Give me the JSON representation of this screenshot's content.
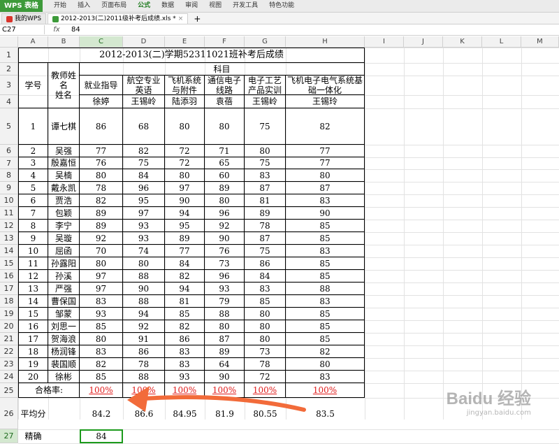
{
  "app": {
    "logo": "WPS 表格",
    "menu": [
      "开始",
      "插入",
      "页面布局",
      "公式",
      "数据",
      "审阅",
      "视图",
      "开发工具",
      "特色功能"
    ],
    "active_menu": "公式"
  },
  "tabs": [
    {
      "label": "我的WPS"
    },
    {
      "label": "2012-2013(二)2011级补考后成绩.xls *"
    }
  ],
  "formula_bar": {
    "cell_ref": "C27",
    "fx": "fx",
    "value": "84"
  },
  "columns": [
    "A",
    "B",
    "C",
    "D",
    "E",
    "F",
    "G",
    "H",
    "I",
    "J",
    "K",
    "L",
    "M"
  ],
  "rows": [
    "1",
    "2",
    "3",
    "4",
    "5",
    "6",
    "7",
    "8",
    "9",
    "10",
    "11",
    "12",
    "13",
    "14",
    "15",
    "16",
    "17",
    "18",
    "19",
    "20",
    "21",
    "22",
    "23",
    "24",
    "25",
    "26",
    "27"
  ],
  "sheet": {
    "title": "2012-2013(二)学期52311021班补考后成绩",
    "h_xuehao": "学号",
    "h_teacher": "教师姓名\n姓名",
    "h_subject": "科目",
    "subjects": [
      "就业指导",
      "航空专业英语",
      "飞机系统与附件",
      "通信电子线路",
      "电子工艺产品实训",
      "飞机电子电气系统基础一体化"
    ],
    "teachers": [
      "徐婷",
      "王锡岭",
      "陆添羽",
      "袁蓓",
      "王锡岭",
      "王锡玲"
    ],
    "students": [
      {
        "no": "1",
        "name": "谭七棋",
        "scores": [
          "86",
          "68",
          "80",
          "80",
          "75",
          "82"
        ]
      },
      {
        "no": "2",
        "name": "吴强",
        "scores": [
          "77",
          "82",
          "72",
          "71",
          "80",
          "77"
        ]
      },
      {
        "no": "3",
        "name": "殷嘉恒",
        "scores": [
          "76",
          "75",
          "72",
          "65",
          "75",
          "77"
        ]
      },
      {
        "no": "4",
        "name": "吴楠",
        "scores": [
          "80",
          "84",
          "80",
          "60",
          "83",
          "80"
        ]
      },
      {
        "no": "5",
        "name": "戴永凯",
        "scores": [
          "78",
          "96",
          "97",
          "89",
          "87",
          "87"
        ]
      },
      {
        "no": "6",
        "name": "贾浩",
        "scores": [
          "82",
          "95",
          "90",
          "80",
          "81",
          "83"
        ]
      },
      {
        "no": "7",
        "name": "包颖",
        "scores": [
          "89",
          "97",
          "94",
          "96",
          "89",
          "90"
        ]
      },
      {
        "no": "8",
        "name": "李宁",
        "scores": [
          "89",
          "93",
          "95",
          "92",
          "78",
          "85"
        ]
      },
      {
        "no": "9",
        "name": "吴璇",
        "scores": [
          "92",
          "93",
          "89",
          "90",
          "87",
          "85"
        ]
      },
      {
        "no": "10",
        "name": "屈函",
        "scores": [
          "70",
          "74",
          "77",
          "76",
          "75",
          "83"
        ]
      },
      {
        "no": "11",
        "name": "孙露阳",
        "scores": [
          "80",
          "80",
          "84",
          "73",
          "86",
          "85"
        ]
      },
      {
        "no": "12",
        "name": "孙溪",
        "scores": [
          "97",
          "88",
          "82",
          "96",
          "84",
          "85"
        ]
      },
      {
        "no": "13",
        "name": "严强",
        "scores": [
          "97",
          "90",
          "94",
          "93",
          "83",
          "88"
        ]
      },
      {
        "no": "14",
        "name": "曹保国",
        "scores": [
          "83",
          "88",
          "81",
          "79",
          "85",
          "83"
        ]
      },
      {
        "no": "15",
        "name": "邹蒙",
        "scores": [
          "93",
          "94",
          "85",
          "88",
          "80",
          "85"
        ]
      },
      {
        "no": "16",
        "name": "刘思一",
        "scores": [
          "85",
          "92",
          "82",
          "80",
          "80",
          "85"
        ]
      },
      {
        "no": "17",
        "name": "贺海浪",
        "scores": [
          "80",
          "91",
          "86",
          "87",
          "80",
          "85"
        ]
      },
      {
        "no": "18",
        "name": "杨润锋",
        "scores": [
          "83",
          "86",
          "83",
          "89",
          "73",
          "82"
        ]
      },
      {
        "no": "19",
        "name": "裴国顺",
        "scores": [
          "82",
          "78",
          "83",
          "64",
          "78",
          "80"
        ]
      },
      {
        "no": "20",
        "name": "徐彬",
        "scores": [
          "85",
          "88",
          "93",
          "90",
          "72",
          "83"
        ]
      }
    ],
    "pass_label": "合格率:",
    "pass_rates": [
      "100%",
      "100%",
      "100%",
      "100%",
      "100%",
      "100%"
    ],
    "avg_label": "平均分",
    "averages": [
      "84.2",
      "86.6",
      "84.95",
      "81.9",
      "80.55",
      "83.5"
    ],
    "exact_label": "精确",
    "exact_value": "84"
  },
  "watermark": {
    "brand": "Baidu 经验",
    "url": "jingyan.baidu.com"
  },
  "colors": {
    "selection": "#1b9a1b",
    "arrow": "#f26b3a",
    "wps_green": "#3d9a3a",
    "pass_red": "#e01a1a"
  }
}
